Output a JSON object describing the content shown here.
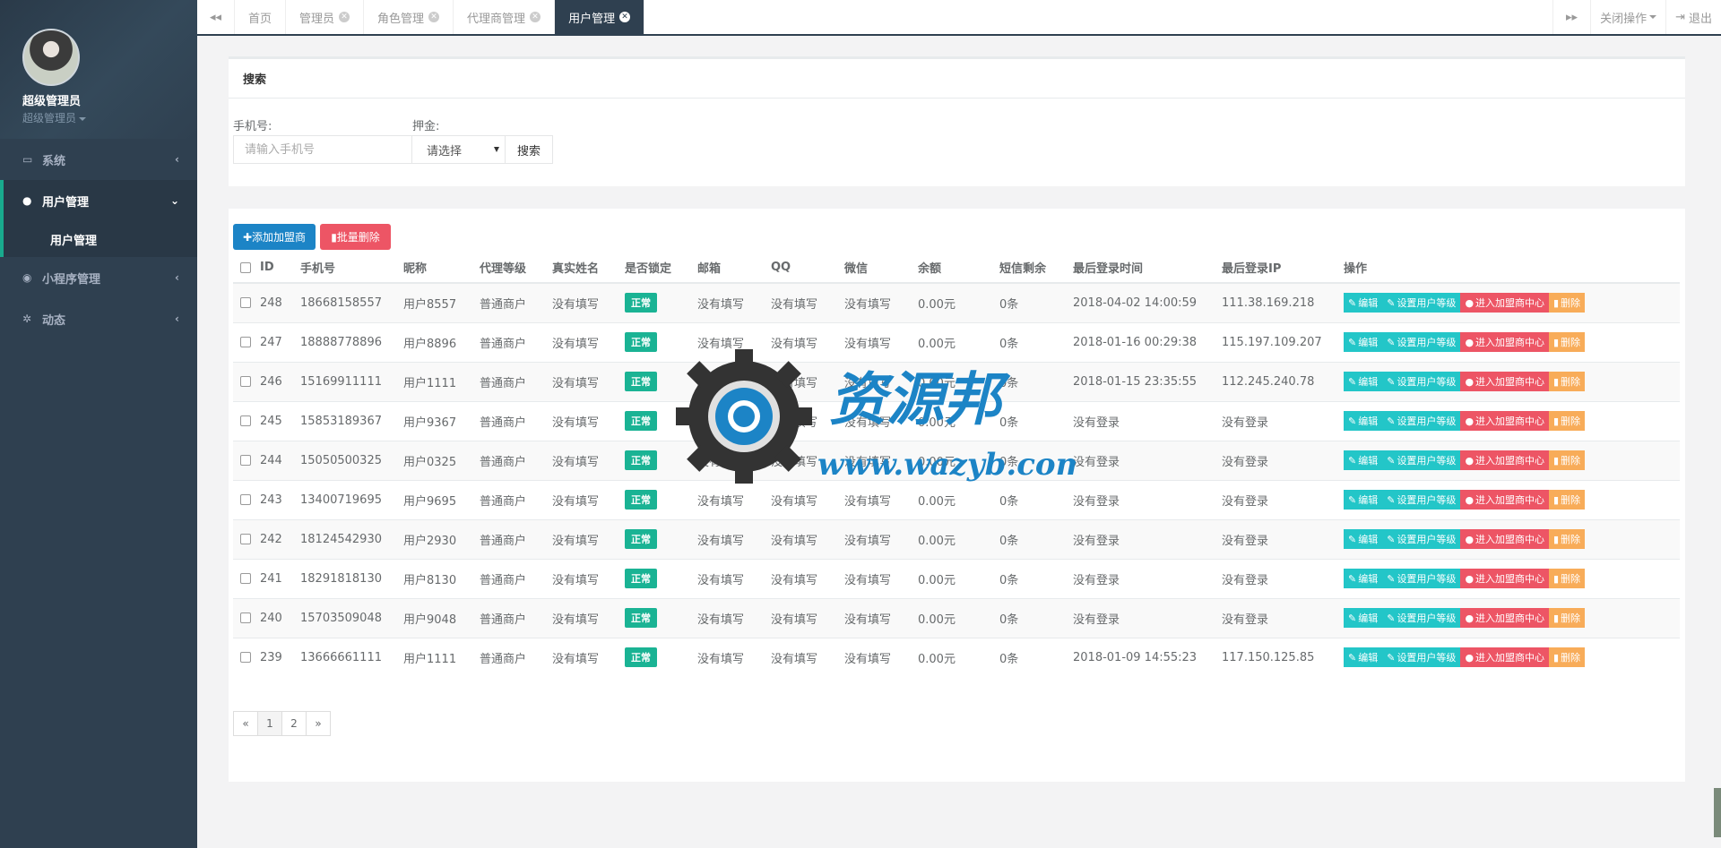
{
  "profile": {
    "name": "超级管理员",
    "role": "超级管理员"
  },
  "sidebar": {
    "items": [
      {
        "label": "系统",
        "icon": "desktop-icon"
      },
      {
        "label": "用户管理",
        "icon": "user-icon"
      },
      {
        "label": "小程序管理",
        "icon": "chat-icon"
      },
      {
        "label": "动态",
        "icon": "cogs-icon"
      }
    ],
    "sub_item": "用户管理"
  },
  "tabs": [
    {
      "label": "首页"
    },
    {
      "label": "管理员"
    },
    {
      "label": "角色管理"
    },
    {
      "label": "代理商管理"
    },
    {
      "label": "用户管理"
    }
  ],
  "tabbar": {
    "close_ops": "关闭操作",
    "logout": "退出"
  },
  "search": {
    "title": "搜索",
    "phone_label": "手机号:",
    "phone_placeholder": "请输入手机号",
    "deposit_label": "押金:",
    "deposit_value": "请选择",
    "button": "搜索"
  },
  "actions": {
    "add": "添加加盟商",
    "batch_delete": "批量删除"
  },
  "table": {
    "headers": [
      "ID",
      "手机号",
      "昵称",
      "代理等级",
      "真实姓名",
      "是否锁定",
      "邮箱",
      "QQ",
      "微信",
      "余额",
      "短信剩余",
      "最后登录时间",
      "最后登录IP",
      "操作"
    ],
    "ops": [
      "编辑",
      "设置用户等级",
      "进入加盟商中心",
      "删除"
    ],
    "rows": [
      {
        "id": "248",
        "phone": "18668158557",
        "nick": "用户8557",
        "level": "普通商户",
        "name": "没有填写",
        "lock": "正常",
        "email": "没有填写",
        "qq": "没有填写",
        "wx": "没有填写",
        "balance": "0.00元",
        "sms": "0条",
        "time": "2018-04-02 14:00:59",
        "ip": "111.38.169.218"
      },
      {
        "id": "247",
        "phone": "18888778896",
        "nick": "用户8896",
        "level": "普通商户",
        "name": "没有填写",
        "lock": "正常",
        "email": "没有填写",
        "qq": "没有填写",
        "wx": "没有填写",
        "balance": "0.00元",
        "sms": "0条",
        "time": "2018-01-16 00:29:38",
        "ip": "115.197.109.207"
      },
      {
        "id": "246",
        "phone": "15169911111",
        "nick": "用户1111",
        "level": "普通商户",
        "name": "没有填写",
        "lock": "正常",
        "email": "没有填写",
        "qq": "没有填写",
        "wx": "没有填写",
        "balance": "0.00元",
        "sms": "0条",
        "time": "2018-01-15 23:35:55",
        "ip": "112.245.240.78"
      },
      {
        "id": "245",
        "phone": "15853189367",
        "nick": "用户9367",
        "level": "普通商户",
        "name": "没有填写",
        "lock": "正常",
        "email": "没有填写",
        "qq": "没有填写",
        "wx": "没有填写",
        "balance": "0.00元",
        "sms": "0条",
        "time": "没有登录",
        "ip": "没有登录"
      },
      {
        "id": "244",
        "phone": "15050500325",
        "nick": "用户0325",
        "level": "普通商户",
        "name": "没有填写",
        "lock": "正常",
        "email": "没有填写",
        "qq": "没有填写",
        "wx": "没有填写",
        "balance": "0.00元",
        "sms": "0条",
        "time": "没有登录",
        "ip": "没有登录"
      },
      {
        "id": "243",
        "phone": "13400719695",
        "nick": "用户9695",
        "level": "普通商户",
        "name": "没有填写",
        "lock": "正常",
        "email": "没有填写",
        "qq": "没有填写",
        "wx": "没有填写",
        "balance": "0.00元",
        "sms": "0条",
        "time": "没有登录",
        "ip": "没有登录"
      },
      {
        "id": "242",
        "phone": "18124542930",
        "nick": "用户2930",
        "level": "普通商户",
        "name": "没有填写",
        "lock": "正常",
        "email": "没有填写",
        "qq": "没有填写",
        "wx": "没有填写",
        "balance": "0.00元",
        "sms": "0条",
        "time": "没有登录",
        "ip": "没有登录"
      },
      {
        "id": "241",
        "phone": "18291818130",
        "nick": "用户8130",
        "level": "普通商户",
        "name": "没有填写",
        "lock": "正常",
        "email": "没有填写",
        "qq": "没有填写",
        "wx": "没有填写",
        "balance": "0.00元",
        "sms": "0条",
        "time": "没有登录",
        "ip": "没有登录"
      },
      {
        "id": "240",
        "phone": "15703509048",
        "nick": "用户9048",
        "level": "普通商户",
        "name": "没有填写",
        "lock": "正常",
        "email": "没有填写",
        "qq": "没有填写",
        "wx": "没有填写",
        "balance": "0.00元",
        "sms": "0条",
        "time": "没有登录",
        "ip": "没有登录"
      },
      {
        "id": "239",
        "phone": "13666661111",
        "nick": "用户1111",
        "level": "普通商户",
        "name": "没有填写",
        "lock": "正常",
        "email": "没有填写",
        "qq": "没有填写",
        "wx": "没有填写",
        "balance": "0.00元",
        "sms": "0条",
        "time": "2018-01-09 14:55:23",
        "ip": "117.150.125.85"
      }
    ]
  },
  "pagination": {
    "prev": "«",
    "pages": [
      "1",
      "2"
    ],
    "next": "»"
  },
  "watermark": {
    "title": "资源邦",
    "url": "www.wazyb.com"
  },
  "colors": {
    "sidebar": "#2f4050",
    "accent": "#19aa8d",
    "teal": "#23c6c8",
    "danger": "#ed5565",
    "warning": "#f8ac59",
    "primary": "#1c84c6",
    "success": "#1ab394"
  }
}
